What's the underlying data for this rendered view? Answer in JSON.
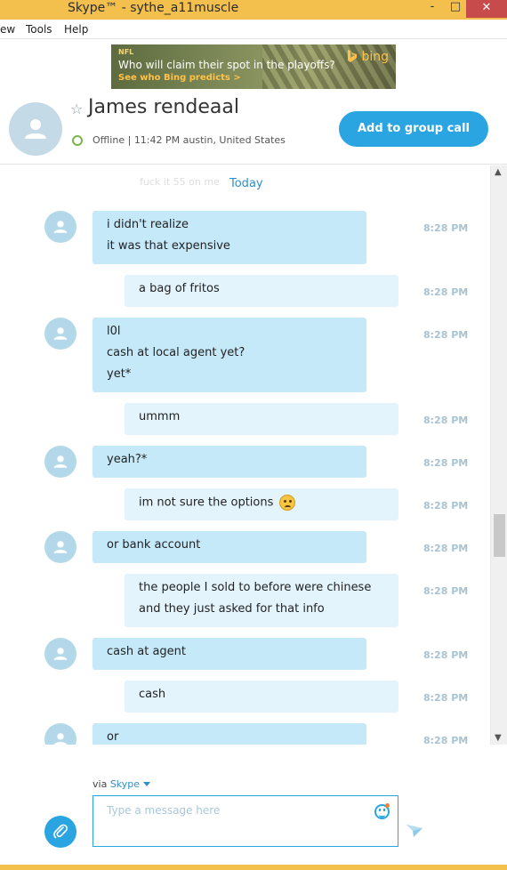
{
  "window": {
    "title": "Skype™ - sythe_a11muscle",
    "minimize": "-",
    "maximize": "□",
    "close": "✕"
  },
  "menu": [
    "ew",
    "Tools",
    "Help"
  ],
  "ad": {
    "tag": "NFL",
    "headline": "Who will claim their spot in the playoffs?",
    "cta": "See who Bing predicts >",
    "brand": "bing"
  },
  "contact": {
    "name": "James rendeaal",
    "status": "Offline",
    "separator": "|",
    "local_time": "11:42 PM austin, United States"
  },
  "actions": {
    "add_to_group_call": "Add to group call"
  },
  "conversation": {
    "faded_previous": "fuck it 55 on me",
    "day_label": "Today",
    "messages": [
      {
        "sender": "them",
        "lines": [
          "i didn't realize",
          "it was that expensive"
        ],
        "time": "8:28 PM"
      },
      {
        "sender": "me",
        "lines": [
          "a bag of fritos"
        ],
        "time": "8:28 PM"
      },
      {
        "sender": "them",
        "lines": [
          "l0l",
          "cash at local agent yet?",
          "yet*"
        ],
        "time": "8:28 PM"
      },
      {
        "sender": "me",
        "lines": [
          "ummm"
        ],
        "time": "8:28 PM"
      },
      {
        "sender": "them",
        "lines": [
          "yeah?*"
        ],
        "time": "8:28 PM"
      },
      {
        "sender": "me",
        "lines": [
          "im not sure the options"
        ],
        "emoji": "worried-emoji",
        "time": "8:28 PM"
      },
      {
        "sender": "them",
        "lines": [
          "or bank account"
        ],
        "time": "8:28 PM"
      },
      {
        "sender": "me",
        "lines": [
          "the people I sold to before were chinese",
          "and they just asked for that info"
        ],
        "time": "8:28 PM"
      },
      {
        "sender": "them",
        "lines": [
          "cash at agent"
        ],
        "time": "8:28 PM"
      },
      {
        "sender": "me",
        "lines": [
          "cash"
        ],
        "time": "8:28 PM"
      },
      {
        "sender": "them",
        "lines": [
          "or"
        ],
        "time": "8:28 PM"
      }
    ]
  },
  "composer": {
    "via_prefix": "via",
    "via_service": "Skype",
    "placeholder": "Type a message here"
  },
  "colors": {
    "accent": "#2aa5e1",
    "incoming_bubble": "#c6e9f9",
    "outgoing_bubble": "#e3f4fc",
    "window_frame": "#f3c04e",
    "offline_ring": "#7ab649"
  },
  "icons": [
    "person-icon",
    "star-icon",
    "presence-offline-icon",
    "attach-icon",
    "emoticon-icon",
    "send-icon",
    "chevron-down-icon",
    "scroll-up-icon",
    "scroll-down-icon"
  ]
}
